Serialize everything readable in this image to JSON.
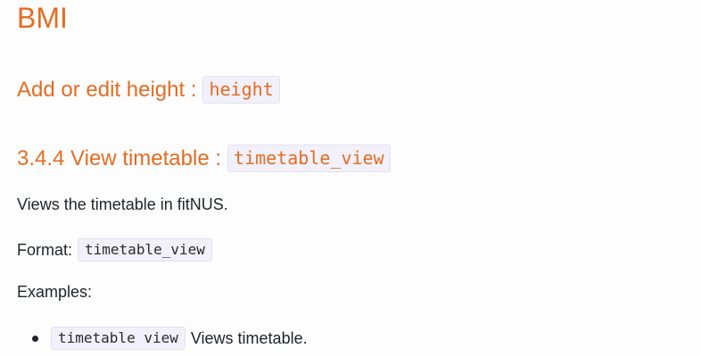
{
  "headings": {
    "bmi": "BMI",
    "add_edit_height": "Add or edit height :",
    "add_edit_height_code": "height",
    "view_timetable": "3.4.4 View timetable :",
    "view_timetable_code": "timetable_view"
  },
  "content": {
    "description": "Views the timetable in fitNUS.",
    "format_label": "Format:",
    "format_code": "timetable_view",
    "examples_label": "Examples:",
    "examples": [
      {
        "code": "timetable view",
        "text": "Views timetable."
      }
    ]
  },
  "colors": {
    "heading": "#e46c21",
    "text": "#212529",
    "code_background": "#f2f0fa"
  }
}
